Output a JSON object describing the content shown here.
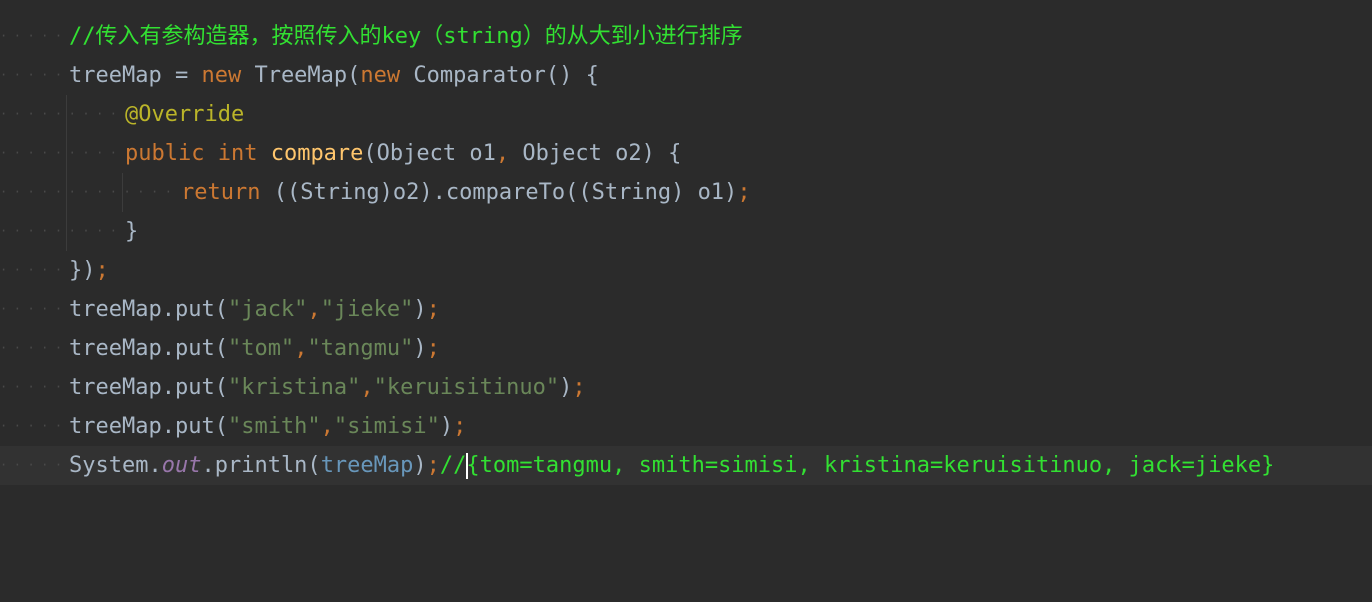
{
  "editor": {
    "lines": [
      {
        "parts": [
          {
            "t": "//传入有参构造器，按照传入的key（string）的从大到小进行排序",
            "c": "cm"
          }
        ]
      },
      {
        "parts": [
          {
            "t": "treeMap = ",
            "c": ""
          },
          {
            "t": "new",
            "c": "kw"
          },
          {
            "t": " TreeMap(",
            "c": ""
          },
          {
            "t": "new",
            "c": "kw"
          },
          {
            "t": " Comparator() {",
            "c": ""
          }
        ]
      },
      {
        "parts": [
          {
            "t": "@Override",
            "c": "ann"
          }
        ]
      },
      {
        "parts": [
          {
            "t": "public int ",
            "c": "kw"
          },
          {
            "t": "compare",
            "c": "fn"
          },
          {
            "t": "(Object o1",
            "c": ""
          },
          {
            "t": ", ",
            "c": "kw"
          },
          {
            "t": "Object o2) {",
            "c": ""
          }
        ]
      },
      {
        "parts": [
          {
            "t": "return ",
            "c": "kw"
          },
          {
            "t": "((String)o2).compareTo((String) o1)",
            "c": ""
          },
          {
            "t": ";",
            "c": "kw"
          }
        ]
      },
      {
        "parts": [
          {
            "t": "}",
            "c": ""
          }
        ]
      },
      {
        "parts": [
          {
            "t": "})",
            "c": ""
          },
          {
            "t": ";",
            "c": "kw"
          }
        ]
      },
      {
        "parts": [
          {
            "t": "treeMap.put(",
            "c": ""
          },
          {
            "t": "\"jack\"",
            "c": "str"
          },
          {
            "t": ",",
            "c": "kw"
          },
          {
            "t": "\"jieke\"",
            "c": "str"
          },
          {
            "t": ")",
            "c": ""
          },
          {
            "t": ";",
            "c": "kw"
          }
        ]
      },
      {
        "parts": [
          {
            "t": "treeMap.put(",
            "c": ""
          },
          {
            "t": "\"tom\"",
            "c": "str"
          },
          {
            "t": ",",
            "c": "kw"
          },
          {
            "t": "\"tangmu\"",
            "c": "str"
          },
          {
            "t": ")",
            "c": ""
          },
          {
            "t": ";",
            "c": "kw"
          }
        ]
      },
      {
        "parts": [
          {
            "t": "treeMap.put(",
            "c": ""
          },
          {
            "t": "\"kristina\"",
            "c": "str"
          },
          {
            "t": ",",
            "c": "kw"
          },
          {
            "t": "\"keruisitinuo\"",
            "c": "str"
          },
          {
            "t": ")",
            "c": ""
          },
          {
            "t": ";",
            "c": "kw"
          }
        ]
      },
      {
        "parts": [
          {
            "t": "treeMap.put(",
            "c": ""
          },
          {
            "t": "\"smith\"",
            "c": "str"
          },
          {
            "t": ",",
            "c": "kw"
          },
          {
            "t": "\"simisi\"",
            "c": "str"
          },
          {
            "t": ")",
            "c": ""
          },
          {
            "t": ";",
            "c": "kw"
          }
        ]
      },
      {
        "parts": [
          {
            "t": "System.",
            "c": ""
          },
          {
            "t": "out",
            "c": "field"
          },
          {
            "t": ".println(",
            "c": ""
          },
          {
            "t": "treeMap",
            "c": "param"
          },
          {
            "t": ")",
            "c": ""
          },
          {
            "t": ";",
            "c": "kw"
          },
          {
            "t": "//",
            "c": "cm"
          },
          {
            "t": "{tom=tangmu, smith=simisi, kristina=keruisitinuo, jack=jieke}",
            "c": "cm"
          }
        ]
      }
    ]
  }
}
